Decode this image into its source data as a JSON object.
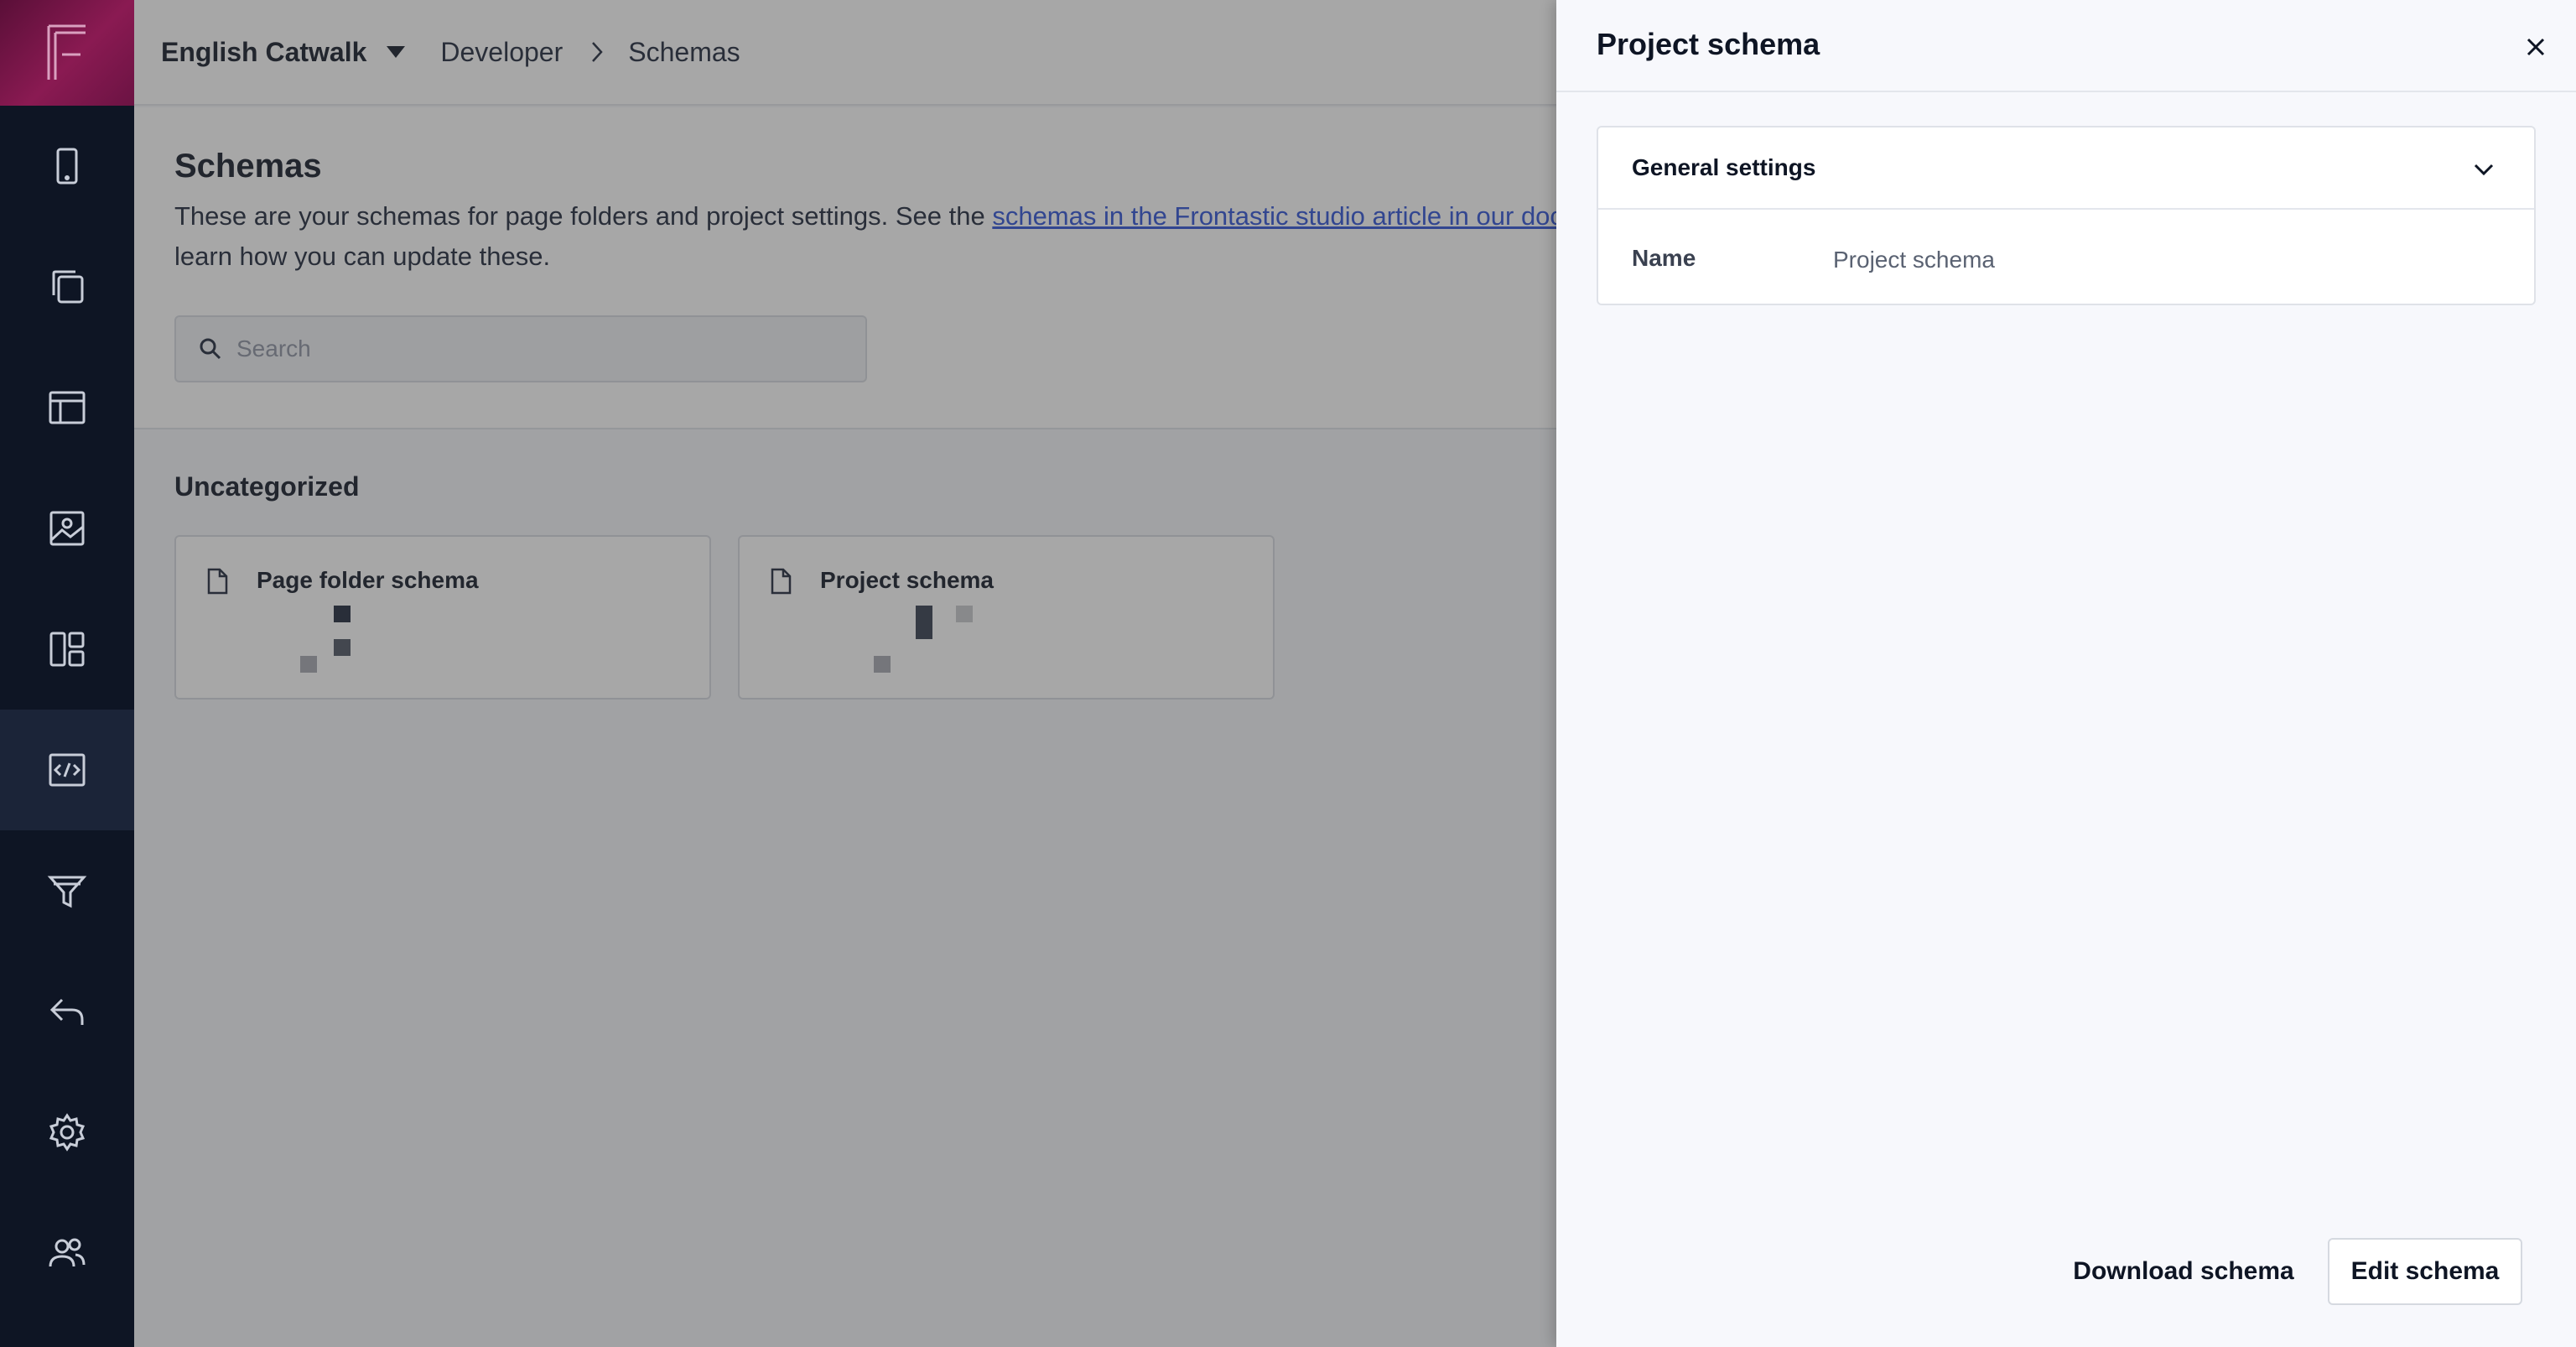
{
  "topbar": {
    "project_name": "English Catwalk",
    "breadcrumb": [
      "Developer",
      "Schemas"
    ]
  },
  "rail": {
    "items": [
      {
        "icon": "mobile-icon"
      },
      {
        "icon": "copy-pages-icon"
      },
      {
        "icon": "layout-icon"
      },
      {
        "icon": "image-icon"
      },
      {
        "icon": "dashboard-icon"
      },
      {
        "icon": "code-icon",
        "active": true
      },
      {
        "icon": "filter-icon"
      },
      {
        "icon": "undo-icon"
      },
      {
        "icon": "gear-icon"
      },
      {
        "icon": "users-icon"
      }
    ]
  },
  "page": {
    "title": "Schemas",
    "desc_before": "These are your schemas for page folders and project settings. See the ",
    "desc_link": "schemas in the Frontastic studio article in our docs",
    "desc_after": " to learn how you can update these.",
    "search_placeholder": "Search",
    "section": "Uncategorized",
    "cards": [
      "Page folder schema",
      "Project schema"
    ]
  },
  "drawer": {
    "title": "Project schema",
    "panel_title": "General settings",
    "field_label": "Name",
    "field_value": "Project schema",
    "download_label": "Download schema",
    "edit_label": "Edit schema"
  },
  "colors": {
    "rail_bg": "#0e1524",
    "logo_accent": "#8a1a52",
    "link": "#2a4fd6"
  }
}
